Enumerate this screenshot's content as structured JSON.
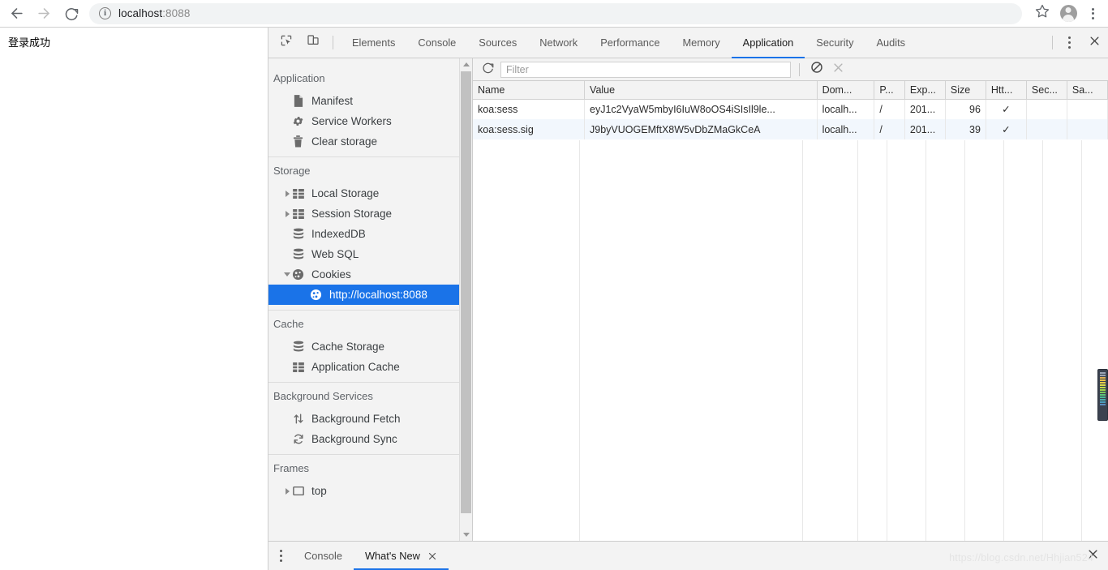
{
  "browser": {
    "back_icon": "arrow-left-icon",
    "forward_icon": "arrow-right-icon",
    "reload_icon": "reload-icon",
    "site_info_icon": "info-circle-icon",
    "url_host": "localhost",
    "url_port": ":8088",
    "bookmark_icon": "star-icon",
    "profile_icon": "avatar-icon",
    "menu_icon": "kebab-menu-icon"
  },
  "page": {
    "content_text": "登录成功"
  },
  "devtools": {
    "inspect_icon": "inspect-element-icon",
    "device_toolbar_icon": "device-toolbar-icon",
    "tabs": [
      {
        "label": "Elements",
        "active": false
      },
      {
        "label": "Console",
        "active": false
      },
      {
        "label": "Sources",
        "active": false
      },
      {
        "label": "Network",
        "active": false
      },
      {
        "label": "Performance",
        "active": false
      },
      {
        "label": "Memory",
        "active": false
      },
      {
        "label": "Application",
        "active": true
      },
      {
        "label": "Security",
        "active": false
      },
      {
        "label": "Audits",
        "active": false
      }
    ],
    "more_icon": "kebab-menu-icon",
    "close_icon": "close-icon",
    "accent_color": "#1a73e8"
  },
  "sidebar": {
    "sections": [
      {
        "title": "Application",
        "items": [
          {
            "label": "Manifest",
            "icon": "document-icon",
            "arrow": "none",
            "selected": false
          },
          {
            "label": "Service Workers",
            "icon": "gear-icon",
            "arrow": "none",
            "selected": false
          },
          {
            "label": "Clear storage",
            "icon": "trash-icon",
            "arrow": "none",
            "selected": false
          }
        ]
      },
      {
        "title": "Storage",
        "items": [
          {
            "label": "Local Storage",
            "icon": "table-icon",
            "arrow": "collapsed",
            "selected": false
          },
          {
            "label": "Session Storage",
            "icon": "table-icon",
            "arrow": "collapsed",
            "selected": false
          },
          {
            "label": "IndexedDB",
            "icon": "database-icon",
            "arrow": "none",
            "selected": false
          },
          {
            "label": "Web SQL",
            "icon": "database-icon",
            "arrow": "none",
            "selected": false
          },
          {
            "label": "Cookies",
            "icon": "cookie-icon",
            "arrow": "expanded",
            "selected": false
          },
          {
            "label": "http://localhost:8088",
            "icon": "cookie-icon",
            "arrow": "none",
            "selected": true
          }
        ]
      },
      {
        "title": "Cache",
        "items": [
          {
            "label": "Cache Storage",
            "icon": "database-icon",
            "arrow": "none",
            "selected": false
          },
          {
            "label": "Application Cache",
            "icon": "table-icon",
            "arrow": "none",
            "selected": false
          }
        ]
      },
      {
        "title": "Background Services",
        "items": [
          {
            "label": "Background Fetch",
            "icon": "up-down-arrows-icon",
            "arrow": "none",
            "selected": false
          },
          {
            "label": "Background Sync",
            "icon": "sync-icon",
            "arrow": "none",
            "selected": false
          }
        ]
      },
      {
        "title": "Frames",
        "items": [
          {
            "label": "top",
            "icon": "frame-icon",
            "arrow": "collapsed",
            "selected": false
          }
        ]
      }
    ]
  },
  "toolbar": {
    "refresh_icon": "refresh-icon",
    "filter_placeholder": "Filter",
    "filter_value": "",
    "clear_all_icon": "clear-all-circle-slash-icon",
    "close_icon": "close-icon"
  },
  "table": {
    "columns": [
      "Name",
      "Value",
      "Dom...",
      "P...",
      "Exp...",
      "Size",
      "Htt...",
      "Sec...",
      "Sa..."
    ],
    "rows": [
      {
        "name": "koa:sess",
        "value": "eyJ1c2VyaW5mbyI6IuW8oOS4iSIsIl9le...",
        "domain": "localh...",
        "path": "/",
        "expires": "201...",
        "size": "96",
        "http_only": "✓",
        "secure": "",
        "same_site": ""
      },
      {
        "name": "koa:sess.sig",
        "value": "J9byVUOGEMftX8W5vDbZMaGkCeA",
        "domain": "localh...",
        "path": "/",
        "expires": "201...",
        "size": "39",
        "http_only": "✓",
        "secure": "",
        "same_site": ""
      }
    ]
  },
  "drawer": {
    "menu_icon": "kebab-menu-icon",
    "tabs": [
      {
        "label": "Console",
        "active": false,
        "closable": false
      },
      {
        "label": "What's New",
        "active": true,
        "closable": true
      }
    ],
    "tab_close_icon": "close-icon",
    "close_icon": "close-icon"
  },
  "watermark": {
    "text": "https://blog.csdn.net/Hhjian524"
  }
}
